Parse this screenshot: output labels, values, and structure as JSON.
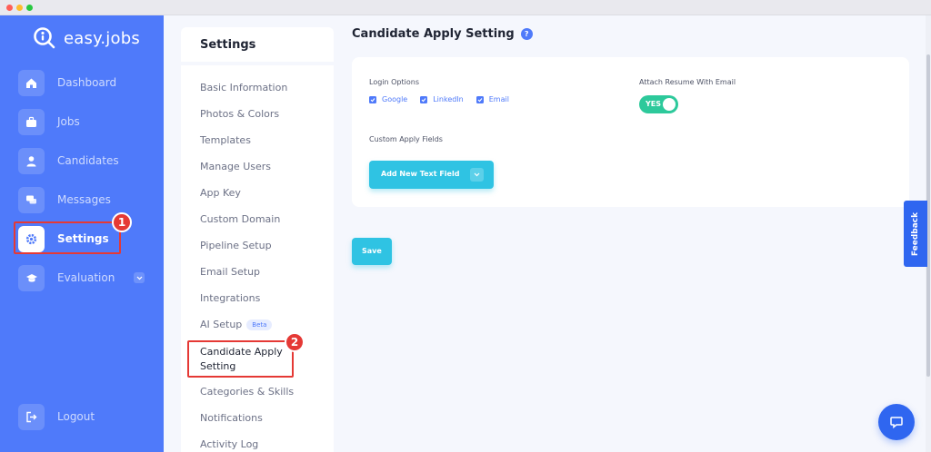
{
  "app": {
    "name": "easy.jobs"
  },
  "sidebar": {
    "items": [
      {
        "label": "Dashboard"
      },
      {
        "label": "Jobs"
      },
      {
        "label": "Candidates"
      },
      {
        "label": "Messages"
      },
      {
        "label": "Settings"
      },
      {
        "label": "Evaluation"
      }
    ],
    "logout": "Logout"
  },
  "settings_menu": {
    "title": "Settings",
    "items": [
      "Basic Information",
      "Photos & Colors",
      "Templates",
      "Manage Users",
      "App Key",
      "Custom Domain",
      "Pipeline Setup",
      "Email Setup",
      "Integrations",
      "AI Setup",
      "Candidate Apply Setting",
      "Categories & Skills",
      "Notifications",
      "Activity Log"
    ],
    "beta_badge": "Beta"
  },
  "main": {
    "title": "Candidate Apply Setting",
    "help_icon": "?",
    "login_options_label": "Login Options",
    "login_options": [
      "Google",
      "LinkedIn",
      "Email"
    ],
    "attach_resume_label": "Attach Resume With Email",
    "attach_resume_toggle": "YES",
    "custom_fields_label": "Custom Apply Fields",
    "add_field_button": "Add New Text Field",
    "save_button": "Save"
  },
  "feedback_tab": "Feedback",
  "annotations": [
    "1",
    "2"
  ],
  "colors": {
    "sidebar": "#4f7afa",
    "accent": "#2fc3e3",
    "toggle_on": "#2dc99b",
    "annotation": "#e53935"
  }
}
